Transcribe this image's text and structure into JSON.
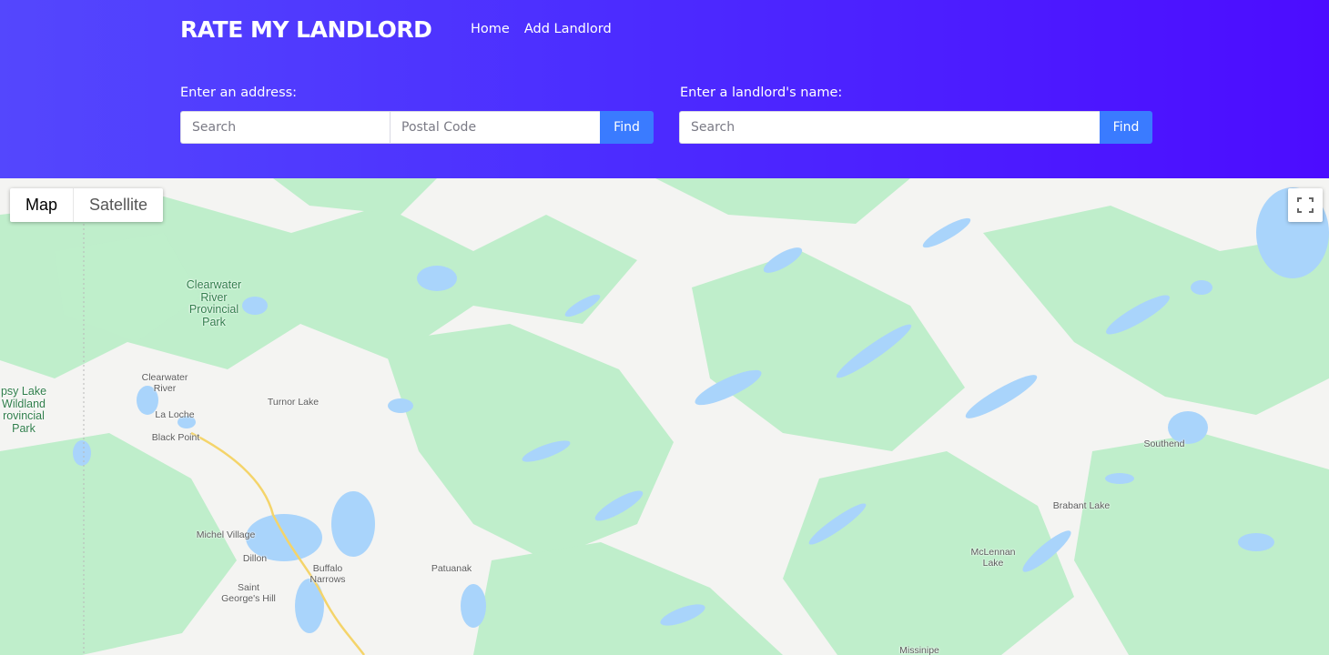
{
  "header": {
    "brand": "RATE MY LANDLORD",
    "nav": [
      "Home",
      "Add Landlord"
    ]
  },
  "address_search": {
    "label": "Enter an address:",
    "search_placeholder": "Search",
    "postal_placeholder": "Postal Code",
    "button": "Find"
  },
  "landlord_search": {
    "label": "Enter a landlord's name:",
    "search_placeholder": "Search",
    "button": "Find"
  },
  "map": {
    "type_buttons": {
      "map": "Map",
      "satellite": "Satellite"
    },
    "places": {
      "clearwater_park": [
        "Clearwater",
        "River",
        "Provincial",
        "Park"
      ],
      "gipsy_lake": [
        "psy Lake",
        "Wildland",
        "rovincial",
        "Park"
      ],
      "clearwater_river": [
        "Clearwater",
        "River"
      ],
      "turnor_lake": "Turnor Lake",
      "la_loche": "La Loche",
      "black_point": "Black Point",
      "michel_village": "Michel Village",
      "dillon": "Dillon",
      "buffalo_narrows": [
        "Buffalo",
        "Narrows"
      ],
      "saint_georges_hill": [
        "Saint",
        "George's Hill"
      ],
      "patuanak": "Patuanak",
      "southend": "Southend",
      "brabant_lake": "Brabant Lake",
      "mclennan_lake": [
        "McLennan",
        "Lake"
      ],
      "missinipe": "Missinipe"
    },
    "colors": {
      "forest": "#bfeecb",
      "water": "#a9d4fb",
      "land": "#f4f4f2",
      "highway": "#f4d46a"
    }
  }
}
